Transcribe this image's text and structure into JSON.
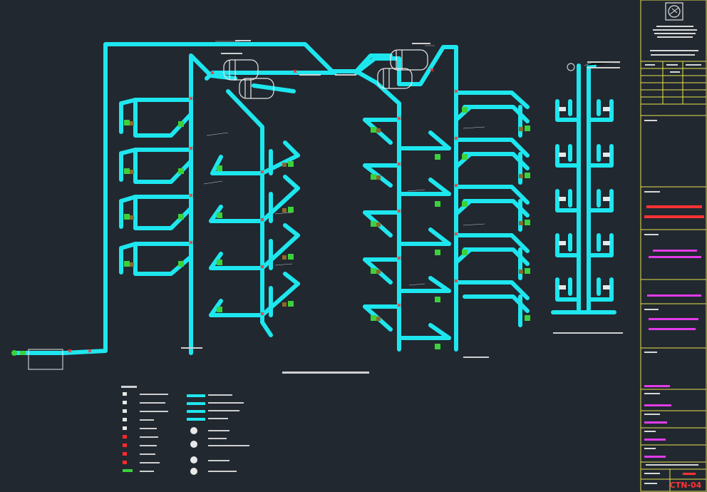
{
  "title_block": {
    "drawing_code": "CTN-04"
  },
  "colors": {
    "background": "#212830",
    "pipe": "#1ee6ee",
    "frame": "#e7e24a",
    "title_red": "#ff3333",
    "title_magenta": "#e23be8",
    "fixture_green": "#3bd13b",
    "valve_red": "#ff2a2a"
  },
  "icons": [
    "logo-icon",
    "water-tank-icon",
    "fixture-icon",
    "valve-icon",
    "water-meter-icon",
    "pump-icon"
  ]
}
